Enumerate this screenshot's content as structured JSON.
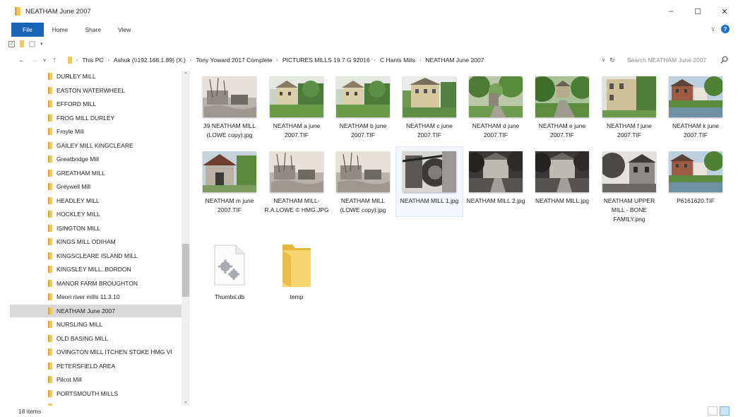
{
  "window": {
    "title": "NEATHAM June 2007",
    "minimize": "–",
    "maximize": "☐",
    "close": "✕"
  },
  "ribbon": {
    "tabs": [
      "File",
      "Home",
      "Share",
      "View"
    ],
    "expand": "∨",
    "help": "?"
  },
  "address": {
    "crumbs": [
      "This PC",
      "Ashok (\\\\192.168.1.89) (X:)",
      "Tony Yoward 2017 Complete",
      "PICTURES MILLS 19.7 G 92016",
      "C Hants Mills",
      "NEATHAM June 2007"
    ],
    "search_placeholder": "Search NEATHAM June 2007"
  },
  "nav": {
    "items": [
      "DURLEY MILL",
      "EASTON WATERWHEEL",
      "EFFORD MILL",
      "FROG MILL DURLEY",
      "Froyle Mill",
      "GAILEY  MILL  KINGCLEARE",
      "Greatbridge Mill",
      "GREATHAM MILL",
      "Greywell Mill",
      "HEADLEY MILL",
      "HOCKLEY MILL",
      "ISINGTON MILL",
      "KINGS MILL  ODIHAM",
      "KINGSCLEARE ISLAND MILL",
      "KINGSLEY MILL..BORDON",
      "MANOR FARM BROUGHTON",
      "Meon river mills 11.3.10",
      "NEATHAM June 2007",
      "NURSLING MILL",
      "OLD  BASING  MILL",
      "OVINGTON MILL ITCHEN STOKE HMG VI",
      "PETERSFIELD  AREA",
      "Pilcot Mill",
      "PORTSMOUTH MILLS"
    ],
    "selected": "NEATHAM June 2007"
  },
  "files": [
    {
      "name": "39 NEATHAM MILL (LOWE copy).jpg",
      "kind": "bw-old"
    },
    {
      "name": "NEATHAM  a june 2007.TIF",
      "kind": "house-green"
    },
    {
      "name": "NEATHAM  b june 2007.TIF",
      "kind": "house-green"
    },
    {
      "name": "NEATHAM  c june 2007.TIF",
      "kind": "house-tall"
    },
    {
      "name": "NEATHAM  d june 2007.TIF",
      "kind": "trees"
    },
    {
      "name": "NEATHAM  e june 2007.TIF",
      "kind": "trees-path"
    },
    {
      "name": "NEATHAM  f june 2007.TIF",
      "kind": "wall"
    },
    {
      "name": "NEATHAM  k june 2007.TIF",
      "kind": "river-house"
    },
    {
      "name": "NEATHAM  m june 2007.TIF",
      "kind": "barn"
    },
    {
      "name": "NEATHAM  MILL-R.A.LOWE © HMG.JPG",
      "kind": "bw-old"
    },
    {
      "name": "NEATHAM MILL (LOWE copy).jpg",
      "kind": "bw-old"
    },
    {
      "name": "NEATHAM MILL 1.jpg",
      "kind": "bw-machine"
    },
    {
      "name": "NEATHAM MILL 2.jpg",
      "kind": "bw-dark"
    },
    {
      "name": "NEATHAM MILL.jpg",
      "kind": "bw-dark"
    },
    {
      "name": "NEATHAM UPPER MILL - BONE FAMILY.png",
      "kind": "bw-house"
    },
    {
      "name": "P6161620.TIF",
      "kind": "river-house"
    },
    {
      "name": "Thumbs.db",
      "kind": "system"
    },
    {
      "name": "temp",
      "kind": "folder"
    }
  ],
  "selected_file": "NEATHAM MILL 1.jpg",
  "status": {
    "count": "18 items"
  }
}
